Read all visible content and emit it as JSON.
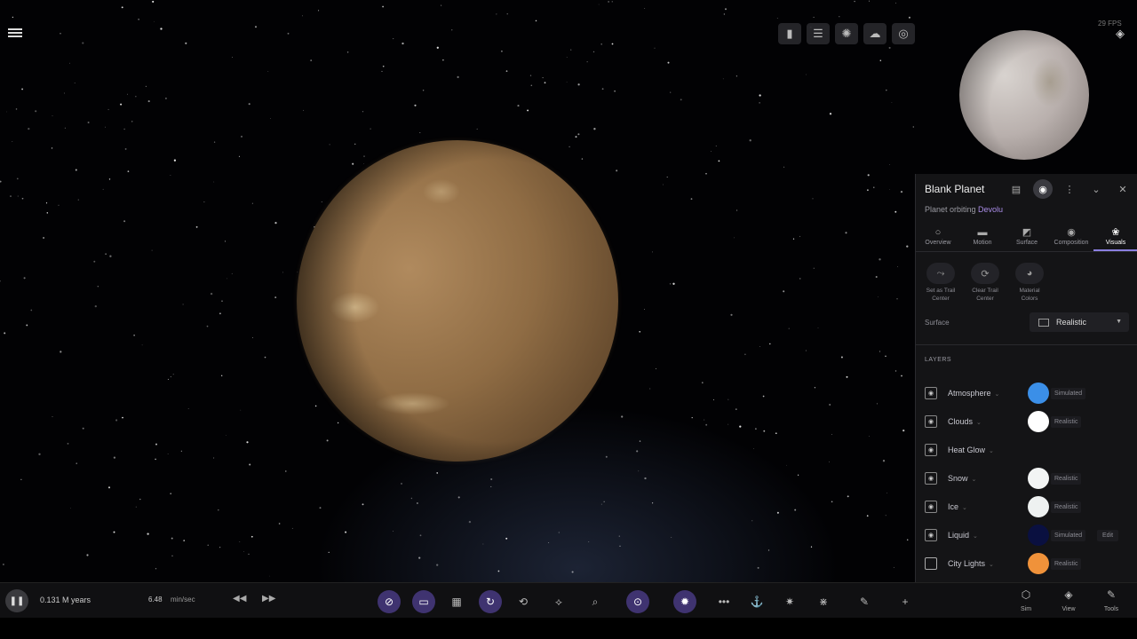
{
  "hud": {
    "fps": "29 FPS"
  },
  "top_toolbar": {
    "items": [
      "flashlight-icon",
      "sliders-icon",
      "atom-icon",
      "cloud-icon",
      "orbit-icon"
    ]
  },
  "panel": {
    "title": "Blank Planet",
    "subtitle_prefix": "Planet orbiting ",
    "subtitle_link": "Devolu",
    "tabs": [
      {
        "label": "Overview",
        "icon": "circle-icon"
      },
      {
        "label": "Motion",
        "icon": "motion-icon"
      },
      {
        "label": "Surface",
        "icon": "surface-icon"
      },
      {
        "label": "Composition",
        "icon": "composition-icon"
      },
      {
        "label": "Visuals",
        "icon": "palette-icon",
        "active": true
      }
    ],
    "actions": [
      {
        "label_line1": "Set as Trail",
        "label_line2": "Center"
      },
      {
        "label_line1": "Clear Trail",
        "label_line2": "Center"
      },
      {
        "label_line1": "Material",
        "label_line2": "Colors"
      }
    ],
    "surface": {
      "label": "Surface",
      "value": "Realistic"
    },
    "layers_title": "LAYERS",
    "layers": [
      {
        "name": "Atmosphere",
        "visible": true,
        "color": "#3b8fe8",
        "mode": "Simulated",
        "extra": ""
      },
      {
        "name": "Clouds",
        "visible": true,
        "color": "#ffffff",
        "mode": "Realistic",
        "extra": ""
      },
      {
        "name": "Heat Glow",
        "visible": true,
        "color": "",
        "mode": "",
        "extra": ""
      },
      {
        "name": "Snow",
        "visible": true,
        "color": "#f2f4f4",
        "mode": "Realistic",
        "extra": ""
      },
      {
        "name": "Ice",
        "visible": true,
        "color": "#eef1f1",
        "mode": "Realistic",
        "extra": ""
      },
      {
        "name": "Liquid",
        "visible": true,
        "color": "#0a1040",
        "mode": "Simulated",
        "extra": "Edit"
      },
      {
        "name": "City Lights",
        "visible": false,
        "color": "#f0923a",
        "mode": "Realistic",
        "extra": ""
      }
    ]
  },
  "bottom_bar": {
    "time": "0.131 M years",
    "speed_value": "6.48",
    "speed_unit": "min/sec",
    "tabs": [
      {
        "label": "Sim",
        "icon": "cube-icon"
      },
      {
        "label": "View",
        "icon": "stack-icon"
      },
      {
        "label": "Tools",
        "icon": "wrench-icon"
      }
    ]
  },
  "colors": {
    "accent": "#8b7fe0",
    "highlight_bg": "#3f3370",
    "link": "#a98ce6"
  }
}
